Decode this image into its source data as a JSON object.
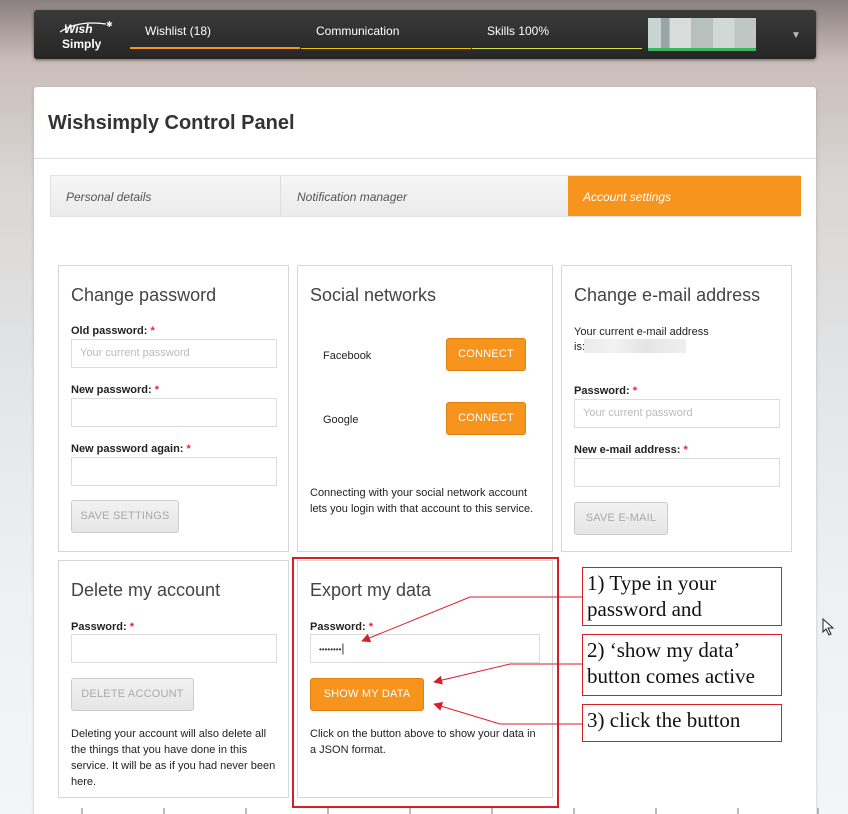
{
  "topnav": {
    "logo_line1": "Wish",
    "logo_line2": "Simply",
    "tabs": [
      {
        "label": "Wishlist (18)",
        "color": "#f7941d"
      },
      {
        "label": "Communication",
        "color": "#f2c200"
      },
      {
        "label": "Skills 100%",
        "color": "#d7e04a"
      }
    ],
    "user_menu_icon": "chevron-down-icon"
  },
  "panel": {
    "title": "Wishsimply Control Panel",
    "subtabs": [
      "Personal details",
      "Notification manager",
      "Account settings"
    ],
    "active_subtab": "Account settings",
    "accent_color": "#f7941d"
  },
  "change_password": {
    "title": "Change password",
    "old_label": "Old password:",
    "old_placeholder": "Your current password",
    "new_label": "New password:",
    "new_again_label": "New password again:",
    "required_mark": "*",
    "save_button": "SAVE SETTINGS"
  },
  "social": {
    "title": "Social networks",
    "networks": [
      {
        "name": "Facebook",
        "button": "CONNECT"
      },
      {
        "name": "Google",
        "button": "CONNECT"
      }
    ],
    "note": "Connecting with your social network account lets you login with that account to this service."
  },
  "change_email": {
    "title": "Change e-mail address",
    "current_text_1": "Your current e-mail address",
    "current_text_2": "is:",
    "password_label": "Password:",
    "password_placeholder": "Your current password",
    "new_email_label": "New e-mail address:",
    "save_button": "SAVE E-MAIL"
  },
  "delete_account": {
    "title": "Delete my account",
    "password_label": "Password:",
    "button": "DELETE ACCOUNT",
    "note": "Deleting your account will also delete all the things that you have done in this service. It will be as if you had never been here."
  },
  "export_data": {
    "title": "Export my data",
    "password_label": "Password:",
    "password_value": "••••••••",
    "button": "SHOW MY DATA",
    "note": "Click on the button above to show your data in a JSON format."
  },
  "annotations": {
    "step1": "1) Type in your password and",
    "step2": "2) ‘show my data’ button comes active",
    "step3": "3) click the button",
    "color": "#d81e28"
  }
}
